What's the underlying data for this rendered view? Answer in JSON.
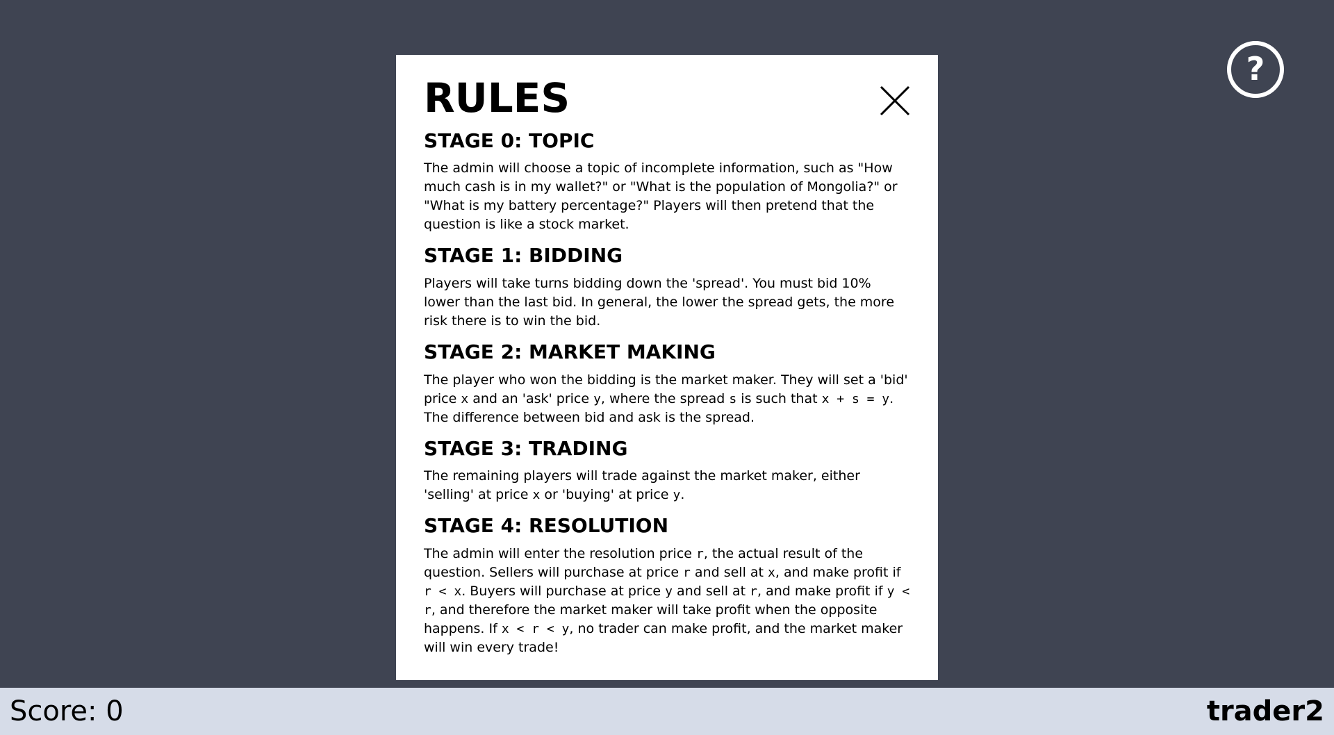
{
  "help": {
    "label": "?"
  },
  "modal": {
    "title": "RULES",
    "stages": [
      {
        "heading": "STAGE 0: TOPIC",
        "segments": [
          {
            "t": "text",
            "v": "The admin will choose a topic of incomplete information, such as \"How much cash is in my wallet?\" or \"What is the population of Mongolia?\" or \"What is my battery percentage?\" Players will then pretend that the question is like a stock market."
          }
        ]
      },
      {
        "heading": "STAGE 1: BIDDING",
        "segments": [
          {
            "t": "text",
            "v": "Players will take turns bidding down the 'spread'. You must bid 10% lower than the last bid. In general, the lower the spread gets, the more risk there is to win the bid."
          }
        ]
      },
      {
        "heading": "STAGE 2: MARKET MAKING",
        "segments": [
          {
            "t": "text",
            "v": "The player who won the bidding is the market maker. They will set a 'bid' price "
          },
          {
            "t": "code",
            "v": "x"
          },
          {
            "t": "text",
            "v": " and an 'ask' price "
          },
          {
            "t": "code",
            "v": "y"
          },
          {
            "t": "text",
            "v": ", where the spread "
          },
          {
            "t": "code",
            "v": "s"
          },
          {
            "t": "text",
            "v": " is such that "
          },
          {
            "t": "code",
            "v": "x + s = y"
          },
          {
            "t": "text",
            "v": ". The difference between bid and ask is the spread."
          }
        ]
      },
      {
        "heading": "STAGE 3: TRADING",
        "segments": [
          {
            "t": "text",
            "v": "The remaining players will trade against the market maker, either 'selling' at price "
          },
          {
            "t": "code",
            "v": "x"
          },
          {
            "t": "text",
            "v": " or 'buying' at price "
          },
          {
            "t": "code",
            "v": "y"
          },
          {
            "t": "text",
            "v": "."
          }
        ]
      },
      {
        "heading": "STAGE 4: RESOLUTION",
        "segments": [
          {
            "t": "text",
            "v": "The admin will enter the resolution price "
          },
          {
            "t": "code",
            "v": "r"
          },
          {
            "t": "text",
            "v": ", the actual result of the question. Sellers will purchase at price "
          },
          {
            "t": "code",
            "v": "r"
          },
          {
            "t": "text",
            "v": " and sell at "
          },
          {
            "t": "code",
            "v": "x"
          },
          {
            "t": "text",
            "v": ", and make profit if "
          },
          {
            "t": "code",
            "v": "r < x"
          },
          {
            "t": "text",
            "v": ". Buyers will purchase at price "
          },
          {
            "t": "code",
            "v": "y"
          },
          {
            "t": "text",
            "v": " and sell at "
          },
          {
            "t": "code",
            "v": "r"
          },
          {
            "t": "text",
            "v": ", and make profit if "
          },
          {
            "t": "code",
            "v": "y < r"
          },
          {
            "t": "text",
            "v": ", and therefore the market maker will take profit when the opposite happens. If "
          },
          {
            "t": "code",
            "v": "x < r < y"
          },
          {
            "t": "text",
            "v": ", no trader can make profit, and the market maker will win every trade!"
          }
        ]
      }
    ]
  },
  "footer": {
    "score": "Score: 0",
    "username": "trader2"
  }
}
